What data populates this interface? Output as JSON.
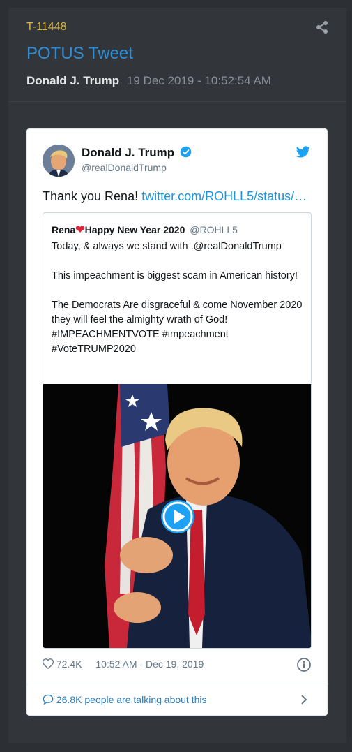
{
  "post": {
    "id": "T-11448",
    "title": "POTUS Tweet",
    "author": "Donald J. Trump",
    "date": "19 Dec 2019 - 10:52:54 AM"
  },
  "tweet": {
    "name": "Donald J. Trump",
    "handle": "@realDonaldTrump",
    "text": "Thank you Rena!",
    "link": "twitter.com/ROHLL5/status/…",
    "likes": "72.4K",
    "timestamp": "10:52 AM - Dec 19, 2019",
    "talking": "26.8K people are talking about this"
  },
  "quote": {
    "name_a": "Rena",
    "heart": "❤",
    "name_b": "Happy New Year 2020",
    "handle": "@ROHLL5",
    "line1": "Today, & always we stand with .@realDonaldTrump",
    "line2": "This impeachment is biggest scam in American history!",
    "line3": "The Democrats Are disgraceful & come November 2020 they will feel the almighty wrath of God! #IMPEACHMENTVOTE #impeachment #VoteTRUMP2020"
  },
  "colors": {
    "accent": "#2e8fd6",
    "id_color": "#d8b73a",
    "twitter_blue": "#1da1f2"
  },
  "icons": {
    "share": "share-icon",
    "verified": "verified-badge-icon",
    "bird": "twitter-bird-icon",
    "play": "play-icon",
    "like": "heart-icon",
    "info": "info-icon",
    "talk": "speech-bubble-icon",
    "chevron": "chevron-right-icon"
  }
}
